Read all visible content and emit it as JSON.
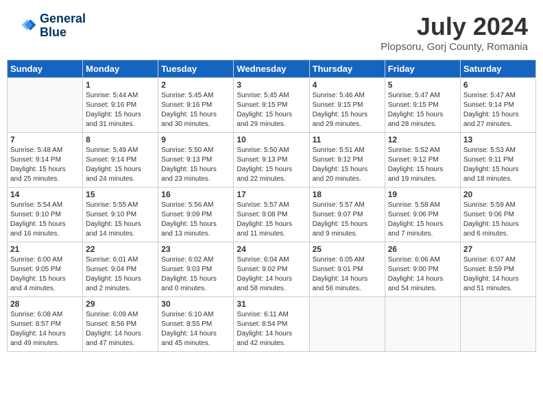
{
  "header": {
    "logo_line1": "General",
    "logo_line2": "Blue",
    "month": "July 2024",
    "location": "Plopsoru, Gorj County, Romania"
  },
  "weekdays": [
    "Sunday",
    "Monday",
    "Tuesday",
    "Wednesday",
    "Thursday",
    "Friday",
    "Saturday"
  ],
  "weeks": [
    [
      {
        "day": "",
        "info": ""
      },
      {
        "day": "1",
        "info": "Sunrise: 5:44 AM\nSunset: 9:16 PM\nDaylight: 15 hours\nand 31 minutes."
      },
      {
        "day": "2",
        "info": "Sunrise: 5:45 AM\nSunset: 9:16 PM\nDaylight: 15 hours\nand 30 minutes."
      },
      {
        "day": "3",
        "info": "Sunrise: 5:45 AM\nSunset: 9:15 PM\nDaylight: 15 hours\nand 29 minutes."
      },
      {
        "day": "4",
        "info": "Sunrise: 5:46 AM\nSunset: 9:15 PM\nDaylight: 15 hours\nand 29 minutes."
      },
      {
        "day": "5",
        "info": "Sunrise: 5:47 AM\nSunset: 9:15 PM\nDaylight: 15 hours\nand 28 minutes."
      },
      {
        "day": "6",
        "info": "Sunrise: 5:47 AM\nSunset: 9:14 PM\nDaylight: 15 hours\nand 27 minutes."
      }
    ],
    [
      {
        "day": "7",
        "info": "Sunrise: 5:48 AM\nSunset: 9:14 PM\nDaylight: 15 hours\nand 25 minutes."
      },
      {
        "day": "8",
        "info": "Sunrise: 5:49 AM\nSunset: 9:14 PM\nDaylight: 15 hours\nand 24 minutes."
      },
      {
        "day": "9",
        "info": "Sunrise: 5:50 AM\nSunset: 9:13 PM\nDaylight: 15 hours\nand 23 minutes."
      },
      {
        "day": "10",
        "info": "Sunrise: 5:50 AM\nSunset: 9:13 PM\nDaylight: 15 hours\nand 22 minutes."
      },
      {
        "day": "11",
        "info": "Sunrise: 5:51 AM\nSunset: 9:12 PM\nDaylight: 15 hours\nand 20 minutes."
      },
      {
        "day": "12",
        "info": "Sunrise: 5:52 AM\nSunset: 9:12 PM\nDaylight: 15 hours\nand 19 minutes."
      },
      {
        "day": "13",
        "info": "Sunrise: 5:53 AM\nSunset: 9:11 PM\nDaylight: 15 hours\nand 18 minutes."
      }
    ],
    [
      {
        "day": "14",
        "info": "Sunrise: 5:54 AM\nSunset: 9:10 PM\nDaylight: 15 hours\nand 16 minutes."
      },
      {
        "day": "15",
        "info": "Sunrise: 5:55 AM\nSunset: 9:10 PM\nDaylight: 15 hours\nand 14 minutes."
      },
      {
        "day": "16",
        "info": "Sunrise: 5:56 AM\nSunset: 9:09 PM\nDaylight: 15 hours\nand 13 minutes."
      },
      {
        "day": "17",
        "info": "Sunrise: 5:57 AM\nSunset: 9:08 PM\nDaylight: 15 hours\nand 11 minutes."
      },
      {
        "day": "18",
        "info": "Sunrise: 5:57 AM\nSunset: 9:07 PM\nDaylight: 15 hours\nand 9 minutes."
      },
      {
        "day": "19",
        "info": "Sunrise: 5:58 AM\nSunset: 9:06 PM\nDaylight: 15 hours\nand 7 minutes."
      },
      {
        "day": "20",
        "info": "Sunrise: 5:59 AM\nSunset: 9:06 PM\nDaylight: 15 hours\nand 6 minutes."
      }
    ],
    [
      {
        "day": "21",
        "info": "Sunrise: 6:00 AM\nSunset: 9:05 PM\nDaylight: 15 hours\nand 4 minutes."
      },
      {
        "day": "22",
        "info": "Sunrise: 6:01 AM\nSunset: 9:04 PM\nDaylight: 15 hours\nand 2 minutes."
      },
      {
        "day": "23",
        "info": "Sunrise: 6:02 AM\nSunset: 9:03 PM\nDaylight: 15 hours\nand 0 minutes."
      },
      {
        "day": "24",
        "info": "Sunrise: 6:04 AM\nSunset: 9:02 PM\nDaylight: 14 hours\nand 58 minutes."
      },
      {
        "day": "25",
        "info": "Sunrise: 6:05 AM\nSunset: 9:01 PM\nDaylight: 14 hours\nand 56 minutes."
      },
      {
        "day": "26",
        "info": "Sunrise: 6:06 AM\nSunset: 9:00 PM\nDaylight: 14 hours\nand 54 minutes."
      },
      {
        "day": "27",
        "info": "Sunrise: 6:07 AM\nSunset: 8:59 PM\nDaylight: 14 hours\nand 51 minutes."
      }
    ],
    [
      {
        "day": "28",
        "info": "Sunrise: 6:08 AM\nSunset: 8:57 PM\nDaylight: 14 hours\nand 49 minutes."
      },
      {
        "day": "29",
        "info": "Sunrise: 6:09 AM\nSunset: 8:56 PM\nDaylight: 14 hours\nand 47 minutes."
      },
      {
        "day": "30",
        "info": "Sunrise: 6:10 AM\nSunset: 8:55 PM\nDaylight: 14 hours\nand 45 minutes."
      },
      {
        "day": "31",
        "info": "Sunrise: 6:11 AM\nSunset: 8:54 PM\nDaylight: 14 hours\nand 42 minutes."
      },
      {
        "day": "",
        "info": ""
      },
      {
        "day": "",
        "info": ""
      },
      {
        "day": "",
        "info": ""
      }
    ]
  ]
}
